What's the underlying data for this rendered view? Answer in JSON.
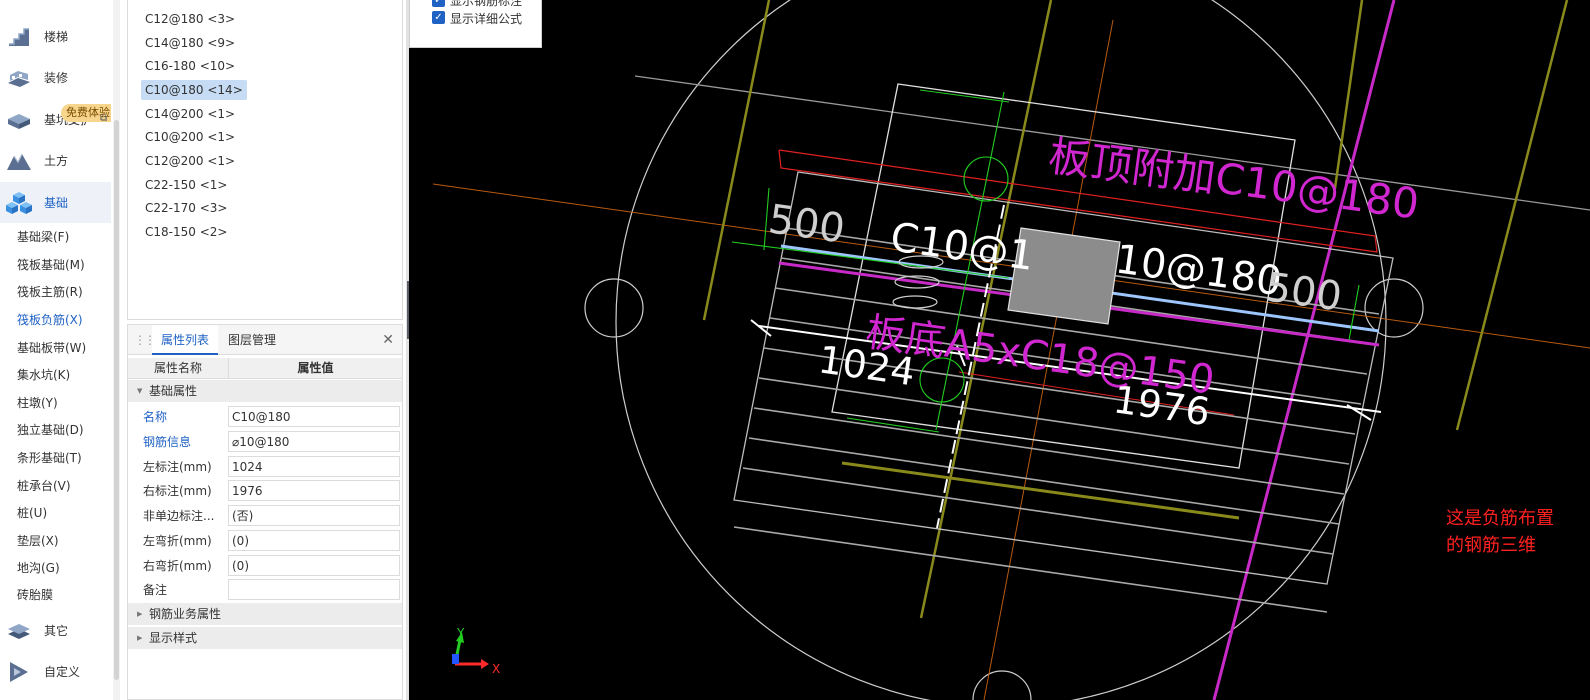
{
  "sidebar": {
    "categories": [
      {
        "label": "楼梯",
        "icon": "stair-icon"
      },
      {
        "label": "装修",
        "icon": "decoration-icon"
      },
      {
        "label": "基坑支护",
        "icon": "pit-support-icon"
      },
      {
        "label": "土方",
        "icon": "earthwork-icon"
      },
      {
        "label": "基础",
        "icon": "foundation-icon"
      },
      {
        "label": "其它",
        "icon": "other-icon"
      },
      {
        "label": "自定义",
        "icon": "custom-icon"
      }
    ],
    "trial_badge": "免费体验",
    "sub_items": [
      {
        "label": "基础梁(F)"
      },
      {
        "label": "筏板基础(M)"
      },
      {
        "label": "筏板主筋(R)"
      },
      {
        "label": "筏板负筋(X)"
      },
      {
        "label": "基础板带(W)"
      },
      {
        "label": "集水坑(K)"
      },
      {
        "label": "柱墩(Y)"
      },
      {
        "label": "独立基础(D)"
      },
      {
        "label": "条形基础(T)"
      },
      {
        "label": "桩承台(V)"
      },
      {
        "label": "桩(U)"
      },
      {
        "label": "垫层(X)"
      },
      {
        "label": "地沟(G)"
      },
      {
        "label": "砖胎膜"
      }
    ]
  },
  "list": {
    "items": [
      {
        "label": "C12@180 <3>"
      },
      {
        "label": "C14@180 <9>"
      },
      {
        "label": "C16-180 <10>"
      },
      {
        "label": "C10@180 <14>"
      },
      {
        "label": "C14@200 <1>"
      },
      {
        "label": "C10@200 <1>"
      },
      {
        "label": "C12@200 <1>"
      },
      {
        "label": "C22-150 <1>"
      },
      {
        "label": "C22-170 <3>"
      },
      {
        "label": "C18-150 <2>"
      }
    ]
  },
  "properties": {
    "tabs": [
      "属性列表",
      "图层管理"
    ],
    "col_name": "属性名称",
    "col_value": "属性值",
    "group_basic": "基础属性",
    "rows": [
      {
        "name": "名称",
        "value": "C10@180"
      },
      {
        "name": "钢筋信息",
        "value": "⌀10@180"
      },
      {
        "name": "左标注(mm)",
        "value": "1024"
      },
      {
        "name": "右标注(mm)",
        "value": "1976"
      },
      {
        "name": "非单边标注...",
        "value": "(否)"
      },
      {
        "name": "左弯折(mm)",
        "value": "(0)"
      },
      {
        "name": "右弯折(mm)",
        "value": "(0)"
      },
      {
        "name": "备注",
        "value": ""
      }
    ],
    "group_business": "钢筋业务属性",
    "group_display": "显示样式"
  },
  "options": {
    "check1": "显示钢筋标注",
    "check2": "显示详细公式"
  },
  "canvas": {
    "label_top_right": "板顶附加C10@180",
    "label_mid_left": "C10@1",
    "label_mid_right": "10@180",
    "label_bottom": "板底A5xC18@150",
    "dim_500_left": "500",
    "dim_500_right": "500",
    "dim_1024": "1024",
    "dim_1976": "1976",
    "axis_x": "X",
    "axis_y": "Y"
  },
  "note": "这是负筋布置的钢筋三维",
  "colors": {
    "accent": "#1f62c4",
    "magenta": "#d027d0",
    "olive": "#8a8a1c",
    "annotation_red": "#ff2020"
  }
}
